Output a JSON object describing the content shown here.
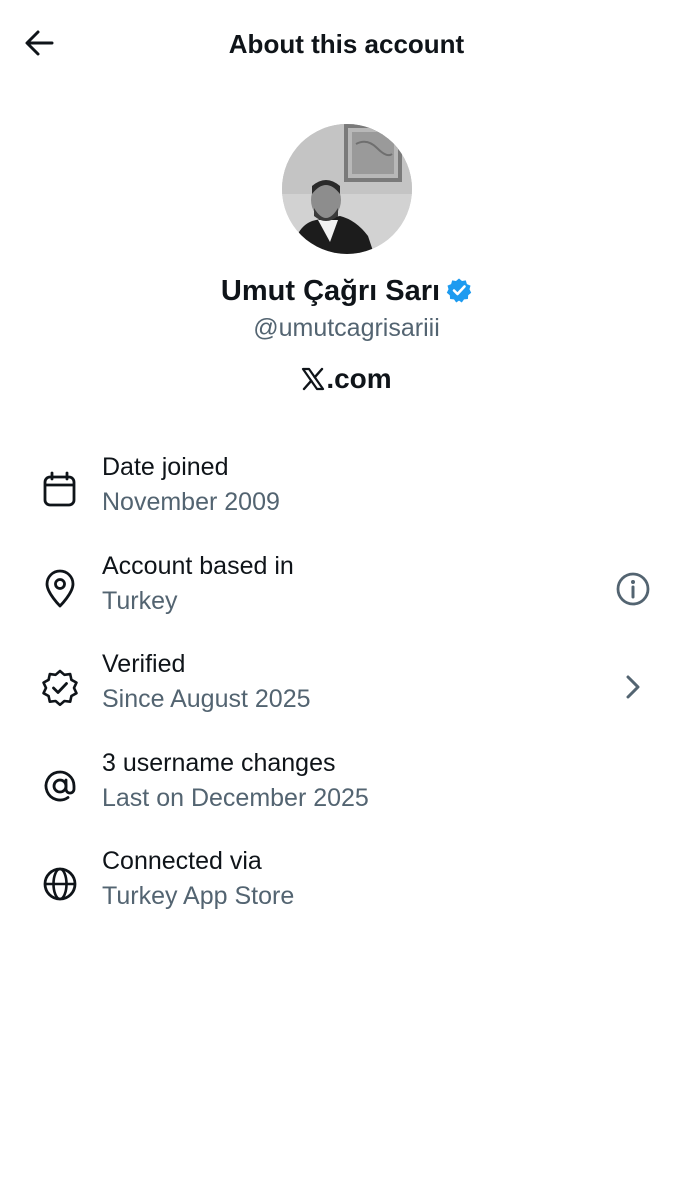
{
  "header": {
    "title": "About this account"
  },
  "profile": {
    "name": "Umut Çağrı Sarı",
    "handle": "@umutcagrisariii",
    "site": ".com",
    "verified_color": "#1d9bf0"
  },
  "rows": [
    {
      "title": "Date joined",
      "subtitle": "November 2009",
      "icon": "calendar-icon"
    },
    {
      "title": "Account based in",
      "subtitle": "Turkey",
      "icon": "location-pin-icon",
      "action_icon": "info-icon"
    },
    {
      "title": "Verified",
      "subtitle": "Since August 2025",
      "icon": "verified-badge-icon",
      "action_icon": "chevron-right-icon"
    },
    {
      "title": "3 username changes",
      "subtitle": "Last on December 2025",
      "icon": "at-sign-icon"
    },
    {
      "title": "Connected via",
      "subtitle": "Turkey App Store",
      "icon": "globe-icon"
    }
  ],
  "colors": {
    "text_primary": "#0f1419",
    "text_secondary": "#536471",
    "accent": "#1d9bf0"
  }
}
